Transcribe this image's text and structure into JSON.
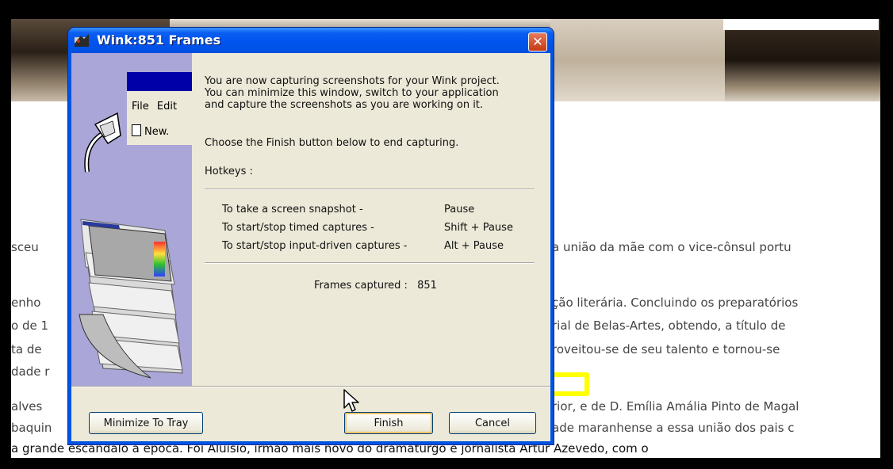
{
  "background": {
    "lines": [
      "sceu",
      "a união da mãe com o vice-cônsul portu",
      "enho",
      "ção literária. Concluindo os preparatórios",
      "o de 1",
      "rial de Belas-Artes, obtendo, a título de",
      "ta de",
      "roveitou-se de seu talento e tornou-se",
      "dade r",
      "alves",
      "rior, e de D. Emília Amália Pinto de Magal",
      "baquin",
      "ade maranhense a essa união dos pais c",
      "a grande escândalo à época. Foi Aluísio, irmão mais novo do dramaturgo e jornalista Artur Azevedo, com o"
    ],
    "arrow_color": "#ffff00"
  },
  "dialog": {
    "title": "Wink:851 Frames",
    "close_label": "✕",
    "mini_menu_file": "File",
    "mini_menu_edit": "Edit",
    "mini_new": "New.",
    "message": [
      "You are now capturing screenshots for your Wink project.",
      "You can minimize this window, switch to your application",
      "and capture the screenshots as you are working on it."
    ],
    "finish_hint": "Choose the Finish button below to end capturing.",
    "hotkeys_label": "Hotkeys :",
    "hotkeys": [
      {
        "action": "To take a screen snapshot -",
        "key": "Pause"
      },
      {
        "action": "To start/stop timed captures -",
        "key": "Shift + Pause"
      },
      {
        "action": "To start/stop input-driven captures -",
        "key": "Alt + Pause"
      }
    ],
    "frames_label": "Frames captured :",
    "frames_value": "851",
    "buttons": {
      "minimize": "Minimize To Tray",
      "finish": "Finish",
      "cancel": "Cancel"
    }
  }
}
